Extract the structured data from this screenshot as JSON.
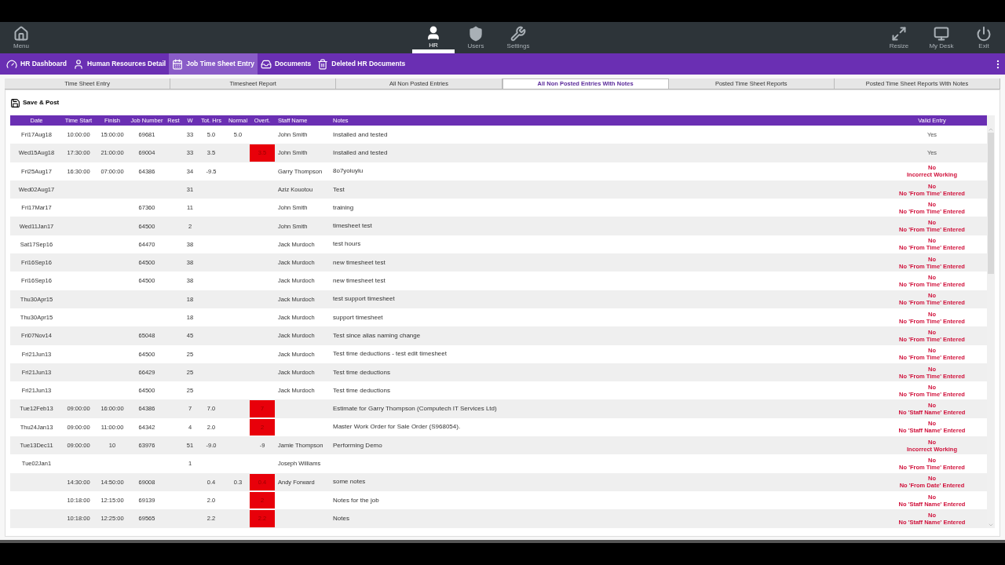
{
  "toolbar": {
    "left": [
      {
        "label": "Menu",
        "selected": false
      }
    ],
    "center": [
      {
        "label": "HR",
        "selected": true
      },
      {
        "label": "Users",
        "selected": false
      },
      {
        "label": "Settings",
        "selected": false
      }
    ],
    "right": [
      {
        "label": "Resize",
        "selected": false
      },
      {
        "label": "My Desk",
        "selected": false
      },
      {
        "label": "Exit",
        "selected": false
      }
    ]
  },
  "nav": [
    {
      "label": "HR Dashboard",
      "selected": false
    },
    {
      "label": "Human Resources Detail",
      "selected": false
    },
    {
      "label": "Job Time Sheet Entry",
      "selected": true
    },
    {
      "label": "Documents",
      "selected": false
    },
    {
      "label": "Deleted HR Documents",
      "selected": false
    }
  ],
  "tabs": [
    {
      "label": "Time Sheet Entry",
      "selected": false
    },
    {
      "label": "Timesheet Report",
      "selected": false
    },
    {
      "label": "All Non Posted Entries",
      "selected": false
    },
    {
      "label": "All Non Posted Entries With Notes",
      "selected": true
    },
    {
      "label": "Posted Time Sheet Reports",
      "selected": false
    },
    {
      "label": "Posted Time Sheet Reports With Notes",
      "selected": false
    }
  ],
  "save_button": "Save & Post",
  "table": {
    "columns": [
      "Date",
      "Time Start",
      "Finish",
      "Job Number",
      "Rest",
      "W",
      "Tot. Hrs",
      "Normal",
      "Overt.",
      "Staff Name",
      "Notes",
      "Valid Entry"
    ],
    "rows": [
      {
        "date": "Fri17Aug18",
        "start": "10:00:00",
        "finish": "15:00:00",
        "job": "69681",
        "w": "33",
        "tot": "5.0",
        "normal": "5.0",
        "staff": "John Smith",
        "notes": "Installed and tested",
        "valid": {
          "ok": true,
          "status": "Yes"
        }
      },
      {
        "date": "Wed15Aug18",
        "start": "17:30:00",
        "finish": "21:00:00",
        "job": "69004",
        "w": "33",
        "tot": "3.5",
        "overt": "3.5",
        "overt_flag": true,
        "staff": "John Smith",
        "notes": "Installed and tested",
        "valid": {
          "ok": true,
          "status": "Yes"
        }
      },
      {
        "date": "Fri25Aug17",
        "start": "16:30:00",
        "finish": "07:00:00",
        "job": "64386",
        "w": "34",
        "tot": "-9.5",
        "staff": "Garry Thompson",
        "notes": "8o7yoiuyiu",
        "valid": {
          "ok": false,
          "status": "No",
          "reason": "Incorrect Working"
        }
      },
      {
        "date": "Wed02Aug17",
        "w": "31",
        "staff": "Aziz Kouotou",
        "notes": "Test",
        "valid": {
          "ok": false,
          "status": "No",
          "reason": "No 'From Time' Entered"
        }
      },
      {
        "date": "Fri17Mar17",
        "job": "67360",
        "w": "11",
        "staff": "John Smith",
        "notes": "training",
        "valid": {
          "ok": false,
          "status": "No",
          "reason": "No 'From Time' Entered"
        }
      },
      {
        "date": "Wed11Jan17",
        "job": "64500",
        "w": "2",
        "staff": "John Smith",
        "notes": "timesheet test",
        "valid": {
          "ok": false,
          "status": "No",
          "reason": "No 'From Time' Entered"
        }
      },
      {
        "date": "Sat17Sep16",
        "job": "64470",
        "w": "38",
        "staff": "Jack Murdoch",
        "notes": "test hours",
        "valid": {
          "ok": false,
          "status": "No",
          "reason": "No 'From Time' Entered"
        }
      },
      {
        "date": "Fri16Sep16",
        "job": "64500",
        "w": "38",
        "staff": "Jack Murdoch",
        "notes": "new timesheet test",
        "valid": {
          "ok": false,
          "status": "No",
          "reason": "No 'From Time' Entered"
        }
      },
      {
        "date": "Fri16Sep16",
        "job": "64500",
        "w": "38",
        "staff": "Jack Murdoch",
        "notes": "new timesheet test",
        "valid": {
          "ok": false,
          "status": "No",
          "reason": "No 'From Time' Entered"
        }
      },
      {
        "date": "Thu30Apr15",
        "w": "18",
        "staff": "Jack Murdoch",
        "notes": "test support timesheet",
        "valid": {
          "ok": false,
          "status": "No",
          "reason": "No 'From Time' Entered"
        }
      },
      {
        "date": "Thu30Apr15",
        "w": "18",
        "staff": "Jack Murdoch",
        "notes": "support timesheet",
        "valid": {
          "ok": false,
          "status": "No",
          "reason": "No 'From Time' Entered"
        }
      },
      {
        "date": "Fri07Nov14",
        "job": "65048",
        "w": "45",
        "staff": "Jack Murdoch",
        "notes": "Test since alias naming change",
        "valid": {
          "ok": false,
          "status": "No",
          "reason": "No 'From Time' Entered"
        }
      },
      {
        "date": "Fri21Jun13",
        "job": "64500",
        "w": "25",
        "staff": "Jack Murdoch",
        "notes": "Test time deductions - test edit timesheet",
        "valid": {
          "ok": false,
          "status": "No",
          "reason": "No 'From Time' Entered"
        }
      },
      {
        "date": "Fri21Jun13",
        "job": "66429",
        "w": "25",
        "staff": "Jack Murdoch",
        "notes": "Test time deductions",
        "valid": {
          "ok": false,
          "status": "No",
          "reason": "No 'From Time' Entered"
        }
      },
      {
        "date": "Fri21Jun13",
        "job": "64500",
        "w": "25",
        "staff": "Jack Murdoch",
        "notes": "Test time deductions",
        "valid": {
          "ok": false,
          "status": "No",
          "reason": "No 'From Time' Entered"
        }
      },
      {
        "date": "Tue12Feb13",
        "start": "09:00:00",
        "finish": "16:00:00",
        "job": "64386",
        "w": "7",
        "tot": "7.0",
        "overt": "7",
        "overt_flag": true,
        "notes": "Estimate for Garry Thompson (Computech IT Services Ltd)",
        "valid": {
          "ok": false,
          "status": "No",
          "reason": "No 'Staff Name' Entered"
        }
      },
      {
        "date": "Thu24Jan13",
        "start": "09:00:00",
        "finish": "11:00:00",
        "job": "64342",
        "w": "4",
        "tot": "2.0",
        "overt": "2",
        "overt_flag": true,
        "notes": "Master Work Order for Sale Order (S968054).",
        "valid": {
          "ok": false,
          "status": "No",
          "reason": "No 'Staff Name' Entered"
        }
      },
      {
        "date": "Tue13Dec11",
        "start": "09:00:00",
        "finish": "10",
        "job": "63976",
        "w": "51",
        "tot": "-9.0",
        "overt": "-9",
        "overt_flag": false,
        "staff": "Jamie Thompson",
        "notes": "Performing Demo",
        "valid": {
          "ok": false,
          "status": "No",
          "reason": "Incorrect Working"
        }
      },
      {
        "date": "Tue02Jan1",
        "w": "1",
        "staff": "Joseph Williams",
        "valid": {
          "ok": false,
          "status": "No",
          "reason": "No 'From Time' Entered"
        }
      },
      {
        "start": "14:30:00",
        "finish": "14:50:00",
        "job": "69008",
        "tot": "0.4",
        "normal": "0.3",
        "overt": "0.4",
        "overt_flag": true,
        "staff": "Andy Forward",
        "notes": "some notes",
        "valid": {
          "ok": false,
          "status": "No",
          "reason": "No 'From Date' Entered"
        }
      },
      {
        "start": "10:18:00",
        "finish": "12:15:00",
        "job": "69139",
        "tot": "2.0",
        "overt": "2",
        "overt_flag": true,
        "notes": "Notes for the job",
        "valid": {
          "ok": false,
          "status": "No",
          "reason": "No 'Staff Name' Entered"
        }
      },
      {
        "start": "10:18:00",
        "finish": "12:25:00",
        "job": "69565",
        "tot": "2.2",
        "overt": "2.2",
        "overt_flag": true,
        "notes": "Notes",
        "valid": {
          "ok": false,
          "status": "No",
          "reason": "No 'Staff Name' Entered"
        }
      }
    ]
  }
}
